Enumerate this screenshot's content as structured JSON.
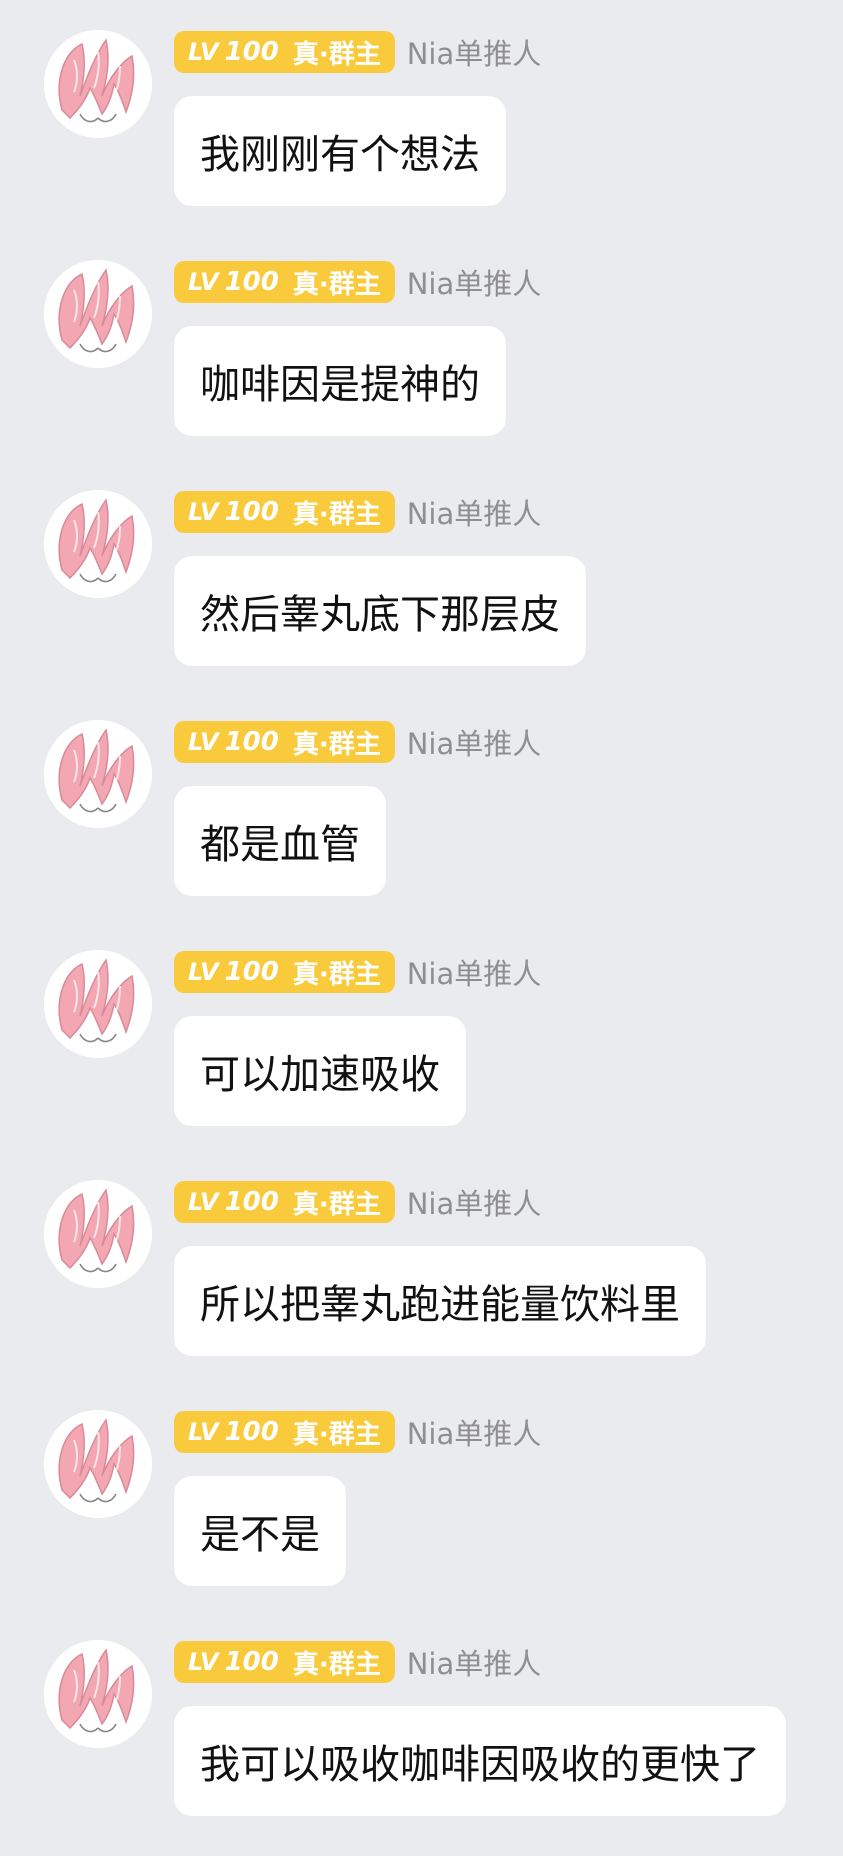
{
  "sender": {
    "badge_lv": "LV",
    "badge_level": "100",
    "badge_title": "真·群主",
    "name": "Nia单推人",
    "avatar_icon": "pink-haired-anime-avatar-icon"
  },
  "messages": [
    {
      "text": "我刚刚有个想法"
    },
    {
      "text": "咖啡因是提神的"
    },
    {
      "text": "然后睾丸底下那层皮"
    },
    {
      "text": "都是血管"
    },
    {
      "text": "可以加速吸收"
    },
    {
      "text": "所以把睾丸跑进能量饮料里"
    },
    {
      "text": "是不是"
    },
    {
      "text": "我可以吸收咖啡因吸收的更快了"
    }
  ],
  "colors": {
    "background": "#eaebef",
    "badge": "#f9cb3c",
    "name": "#8e8e93",
    "bubble": "#ffffff"
  }
}
